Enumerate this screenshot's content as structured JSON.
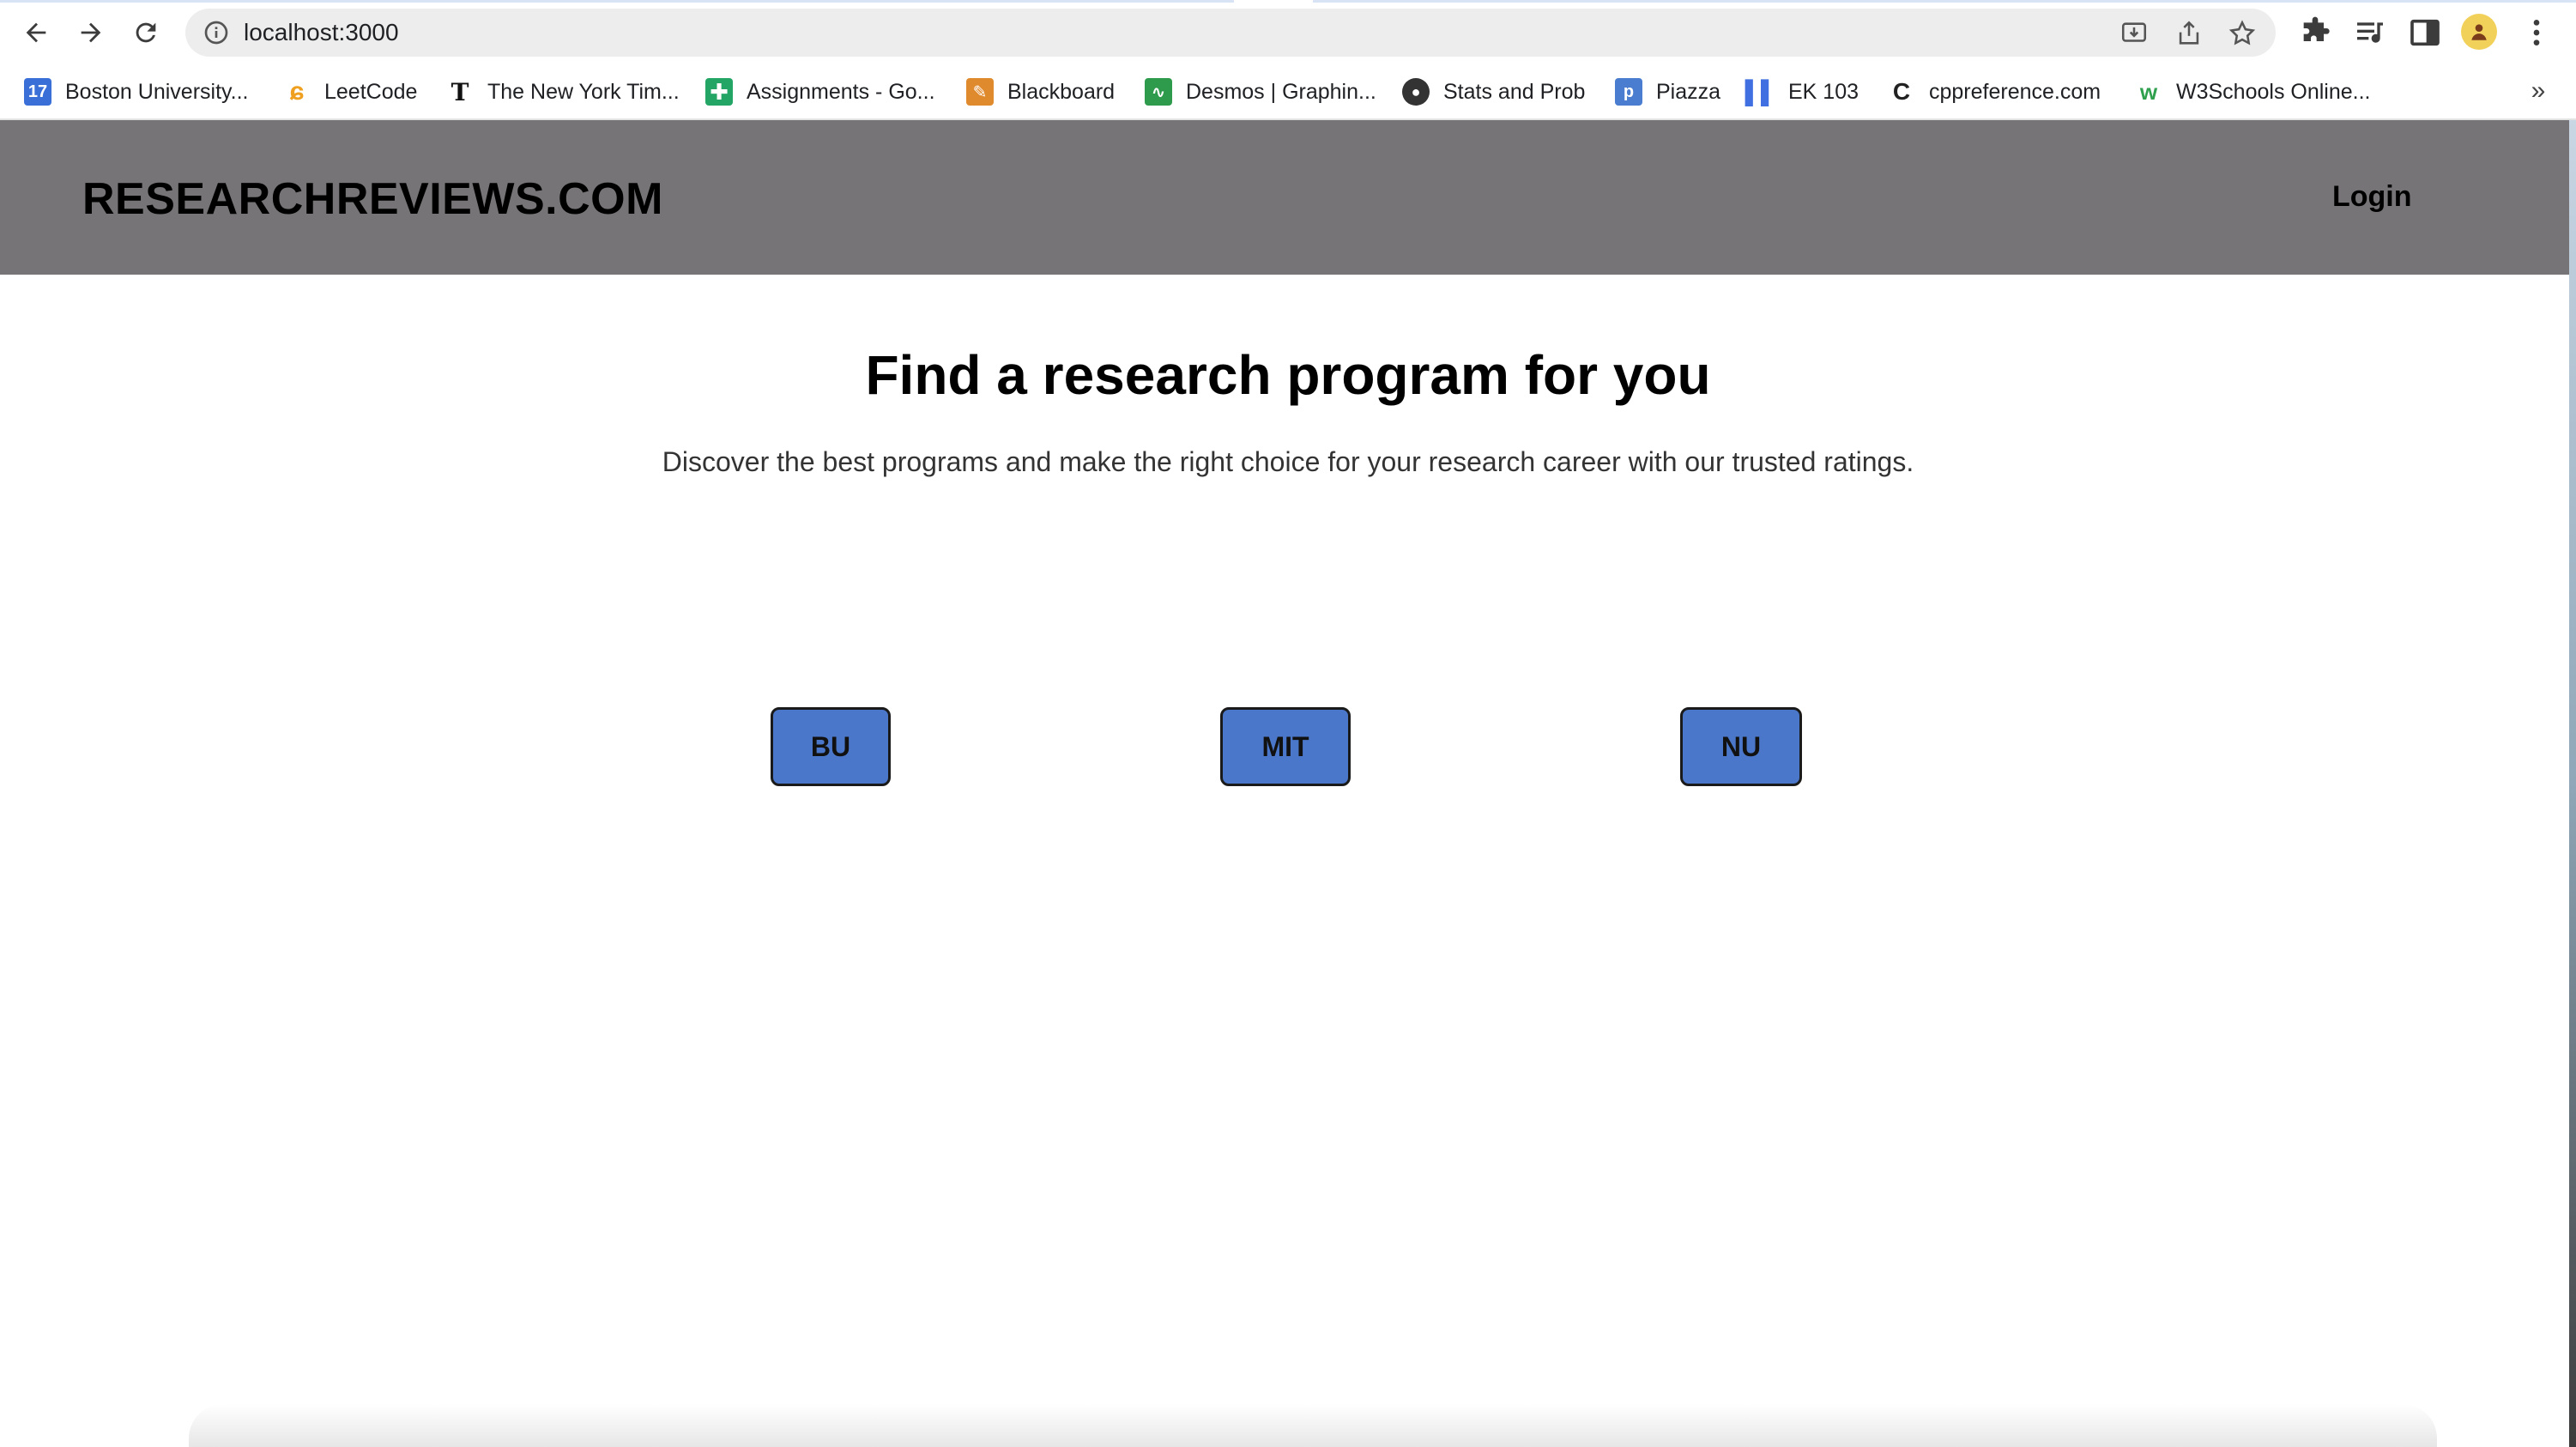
{
  "browser": {
    "url": "localhost:3000",
    "bookmarks": [
      {
        "label": "Boston University...",
        "icon": "calendar-icon",
        "color": "#3b6fd8"
      },
      {
        "label": "LeetCode",
        "icon": "leetcode-icon",
        "color": "#f0a020"
      },
      {
        "label": "The New York Tim...",
        "icon": "nyt-icon",
        "color": "#111111"
      },
      {
        "label": "Assignments - Go...",
        "icon": "sheets-icon",
        "color": "#23a566"
      },
      {
        "label": "Blackboard",
        "icon": "blackboard-icon",
        "color": "#e08a2e"
      },
      {
        "label": "Desmos | Graphin...",
        "icon": "desmos-icon",
        "color": "#2e9a4b"
      },
      {
        "label": "Stats and Prob",
        "icon": "globe-icon",
        "color": "#333333"
      },
      {
        "label": "Piazza",
        "icon": "piazza-icon",
        "color": "#4a7ccf"
      },
      {
        "label": "EK 103",
        "icon": "bar-chart-icon",
        "color": "#3f6fe0"
      },
      {
        "label": "cppreference.com",
        "icon": "cpp-icon",
        "color": "#222222"
      },
      {
        "label": "W3Schools Online...",
        "icon": "w3schools-icon",
        "color": "#2fa04e"
      }
    ]
  },
  "site": {
    "brand": "RESEARCHREVIEWS.COM",
    "login": "Login",
    "hero_title": "Find a research program for you",
    "hero_subtitle": "Discover the best programs and make the right choice for your research career with our trusted ratings.",
    "schools": [
      "BU",
      "MIT",
      "NU"
    ]
  },
  "colors": {
    "header_bg": "#767476",
    "button_bg": "#4a77c9"
  }
}
